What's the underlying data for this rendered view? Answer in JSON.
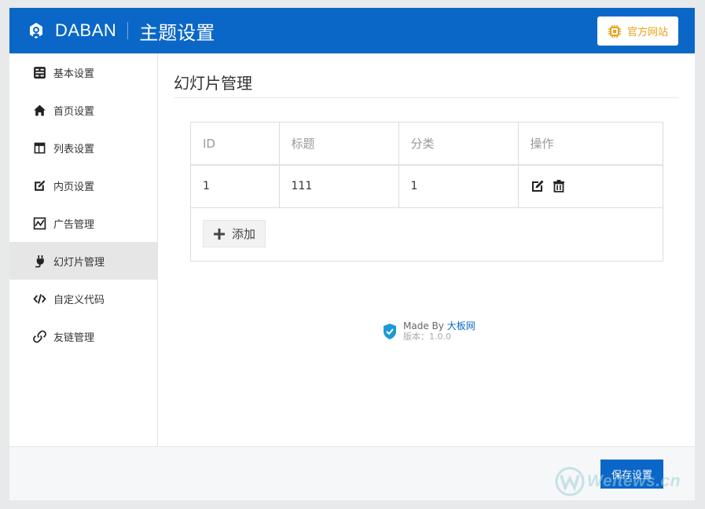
{
  "header": {
    "brand": "DABAN",
    "title": "主题设置",
    "site_button": "官方网站",
    "colors": {
      "bar": "#0a67c8",
      "site_button_text": "#e8a317"
    }
  },
  "sidebar": {
    "items": [
      {
        "label": "基本设置",
        "icon": "settings-grid-icon"
      },
      {
        "label": "首页设置",
        "icon": "home-icon"
      },
      {
        "label": "列表设置",
        "icon": "list-layout-icon"
      },
      {
        "label": "内页设置",
        "icon": "edit-icon"
      },
      {
        "label": "广告管理",
        "icon": "chart-line-icon"
      },
      {
        "label": "幻灯片管理",
        "icon": "plug-icon",
        "active": true
      },
      {
        "label": "自定义代码",
        "icon": "code-icon"
      },
      {
        "label": "友链管理",
        "icon": "link-icon"
      }
    ]
  },
  "main": {
    "title": "幻灯片管理",
    "table": {
      "headers": [
        "ID",
        "标题",
        "分类",
        "操作"
      ],
      "rows": [
        {
          "id": "1",
          "title": "111",
          "category": "1"
        }
      ]
    },
    "add_button": "添加"
  },
  "credit": {
    "made_by": "Made By",
    "author": "大板网",
    "version": "版本：1.0.0"
  },
  "footer": {
    "save_button": "保存设置"
  },
  "watermark": "Weitews.cn"
}
